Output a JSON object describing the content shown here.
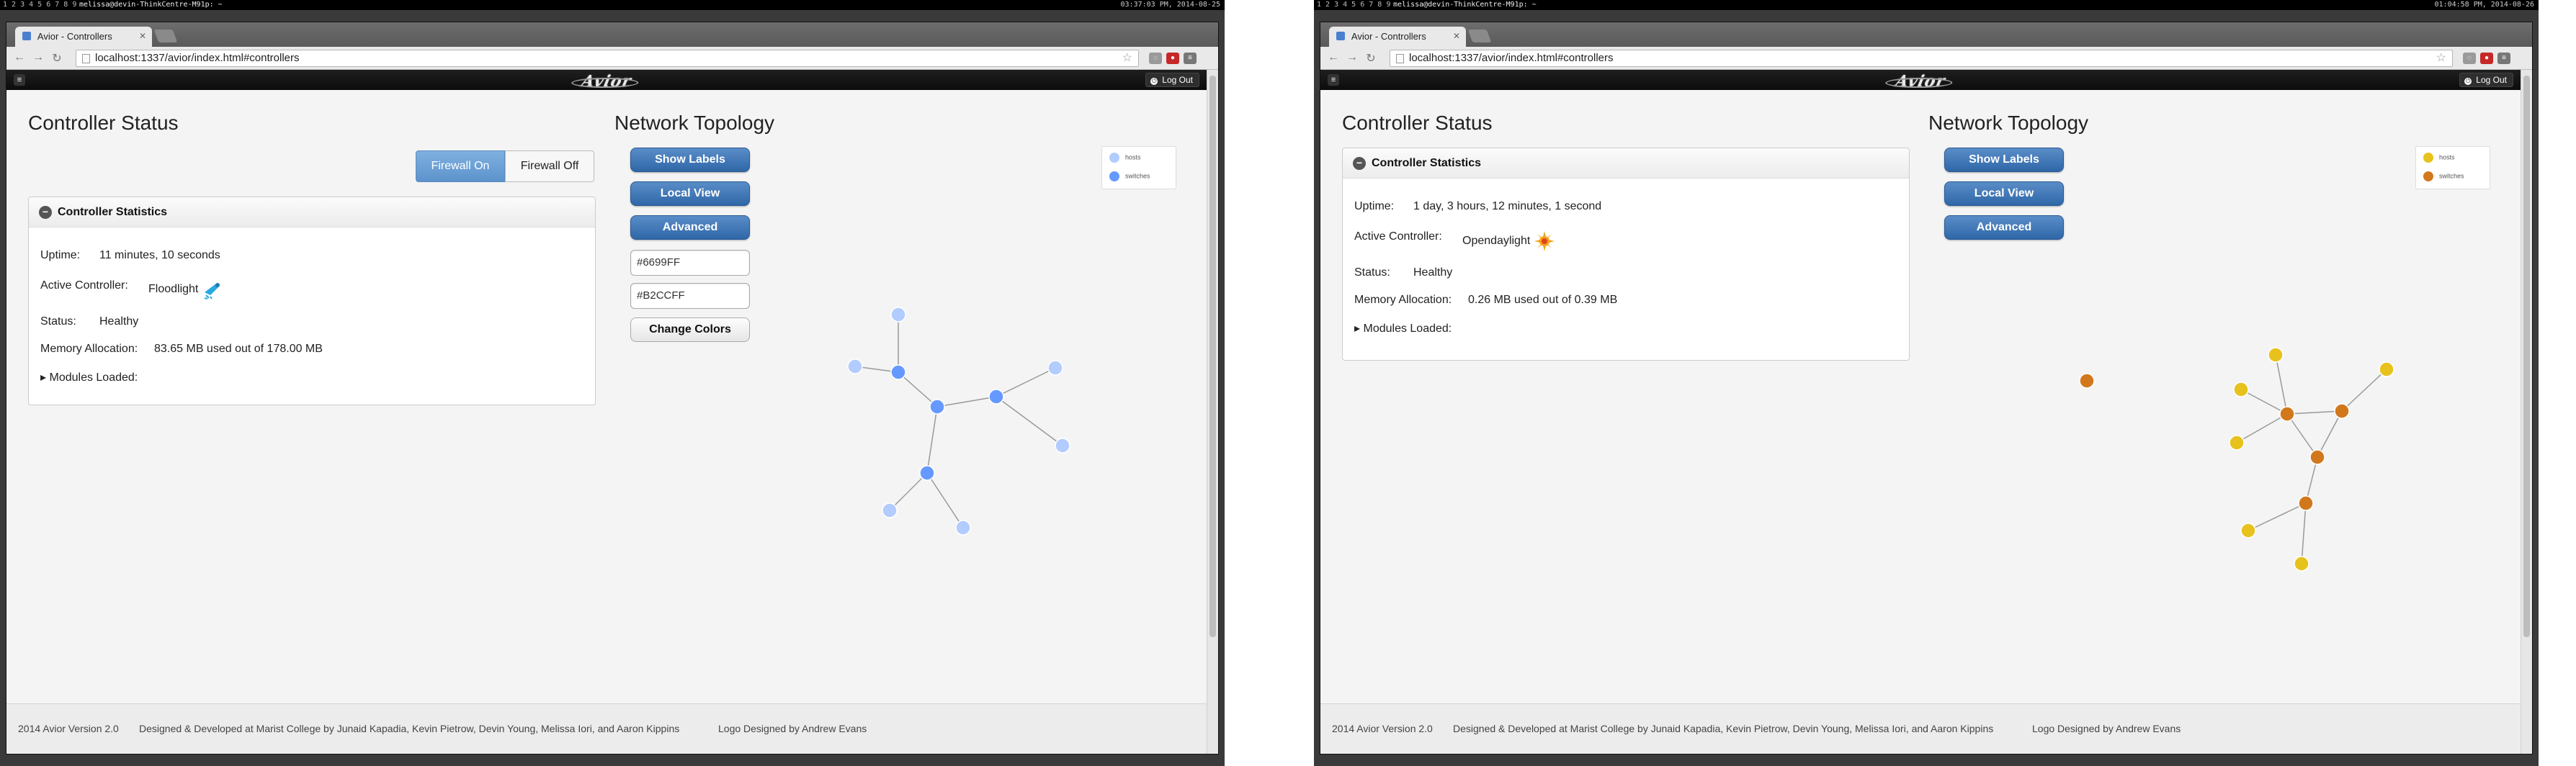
{
  "left": {
    "desktop": {
      "workspaces": "1 2 3 4 5 6 7 8 9",
      "window_title": "melissa@devin-ThinkCentre-M91p: ~",
      "clock": "03:37:03 PM, 2014-08-25"
    },
    "browser": {
      "tab_title": "Avior - Controllers",
      "url": "localhost:1337/avior/index.html#controllers"
    },
    "app": {
      "logo": "Avior",
      "logout_label": "Log Out",
      "controller_status_title": "Controller Status",
      "firewall_on_label": "Firewall On",
      "firewall_off_label": "Firewall Off",
      "stats_title": "Controller Statistics",
      "uptime_label": "Uptime:",
      "uptime_value": "11 minutes, 10 seconds",
      "active_controller_label": "Active Controller:",
      "active_controller_value": "Floodlight",
      "status_label": "Status:",
      "status_value": "Healthy",
      "memory_label": "Memory Allocation:",
      "memory_value": "83.65 MB used out of 178.00 MB",
      "modules_label": "Modules Loaded:",
      "topology_title": "Network Topology",
      "show_labels": "Show Labels",
      "local_view": "Local View",
      "advanced": "Advanced",
      "color_input_1": "#6699FF",
      "color_input_2": "#B2CCFF",
      "change_colors": "Change Colors",
      "legend_hosts": "hosts",
      "legend_switches": "switches",
      "host_color": "#B2CCFF",
      "switch_color": "#6699FF",
      "footer_version": "2014 Avior Version 2.0",
      "footer_credits": "Designed & Developed at Marist College by Junaid Kapadia, Kevin Pietrow, Devin Young, Melissa Iori, and Aaron Kippins",
      "footer_logo": "Logo Designed by Andrew Evans"
    }
  },
  "right": {
    "desktop": {
      "workspaces": "1 2 3 4 5 6 7 8 9",
      "window_title": "melissa@devin-ThinkCentre-M91p: ~",
      "clock": "01:04:58 PM, 2014-08-26"
    },
    "browser": {
      "tab_title": "Avior - Controllers",
      "url": "localhost:1337/avior/index.html#controllers"
    },
    "app": {
      "logo": "Avior",
      "logout_label": "Log Out",
      "controller_status_title": "Controller Status",
      "stats_title": "Controller Statistics",
      "uptime_label": "Uptime:",
      "uptime_value": "1 day, 3 hours, 12 minutes, 1 second",
      "active_controller_label": "Active Controller:",
      "active_controller_value": "Opendaylight",
      "status_label": "Status:",
      "status_value": "Healthy",
      "memory_label": "Memory Allocation:",
      "memory_value": "0.26 MB used out of 0.39 MB",
      "modules_label": "Modules Loaded:",
      "topology_title": "Network Topology",
      "show_labels": "Show Labels",
      "local_view": "Local View",
      "advanced": "Advanced",
      "legend_hosts": "hosts",
      "legend_switches": "switches",
      "host_color": "#E8C21C",
      "switch_color": "#D2781C",
      "footer_version": "2014 Avior Version 2.0",
      "footer_credits": "Designed & Developed at Marist College by Junaid Kapadia, Kevin Pietrow, Devin Young, Melissa Iori, and Aaron Kippins",
      "footer_logo": "Logo Designed by Andrew Evans"
    }
  }
}
